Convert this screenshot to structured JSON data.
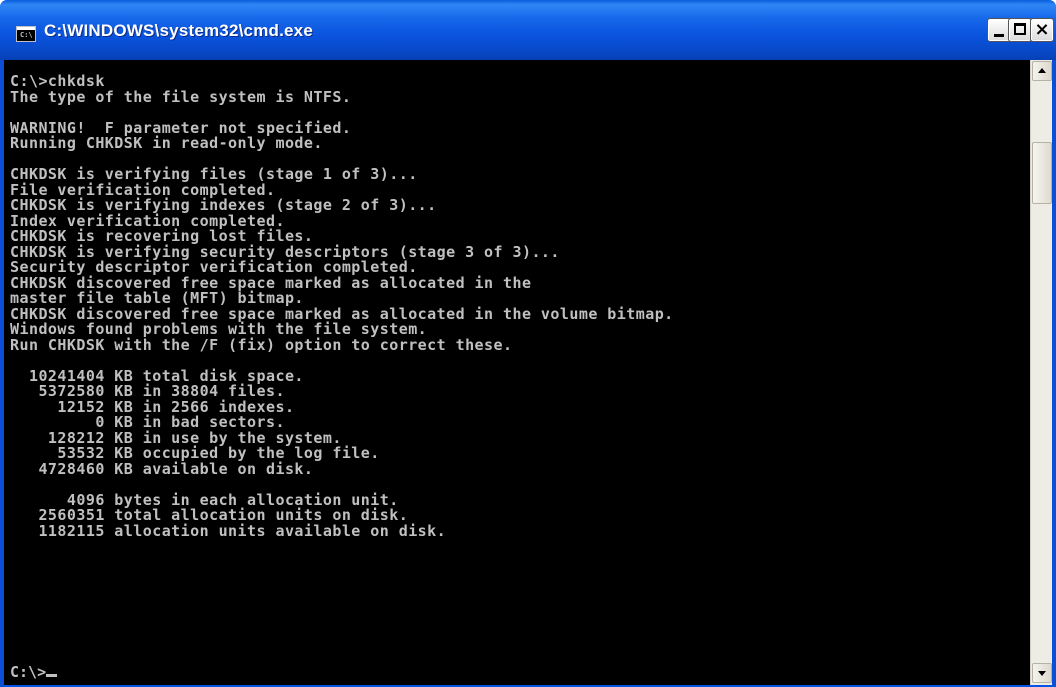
{
  "window": {
    "title": "C:\\WINDOWS\\system32\\cmd.exe",
    "icon_text": "C:\\",
    "icon": "console-icon",
    "buttons": {
      "minimize": "minimize-icon",
      "maximize": "maximize-icon",
      "close_glyph": "×"
    }
  },
  "console": {
    "lines": [
      "C:\\>chkdsk",
      "The type of the file system is NTFS.",
      "",
      "WARNING!  F parameter not specified.",
      "Running CHKDSK in read-only mode.",
      "",
      "CHKDSK is verifying files (stage 1 of 3)...",
      "File verification completed.",
      "CHKDSK is verifying indexes (stage 2 of 3)...",
      "Index verification completed.",
      "CHKDSK is recovering lost files.",
      "CHKDSK is verifying security descriptors (stage 3 of 3)...",
      "Security descriptor verification completed.",
      "CHKDSK discovered free space marked as allocated in the",
      "master file table (MFT) bitmap.",
      "CHKDSK discovered free space marked as allocated in the volume bitmap.",
      "Windows found problems with the file system.",
      "Run CHKDSK with the /F (fix) option to correct these.",
      "",
      "  10241404 KB total disk space.",
      "   5372580 KB in 38804 files.",
      "     12152 KB in 2566 indexes.",
      "         0 KB in bad sectors.",
      "    128212 KB in use by the system.",
      "     53532 KB occupied by the log file.",
      "   4728460 KB available on disk.",
      "",
      "      4096 bytes in each allocation unit.",
      "   2560351 total allocation units on disk.",
      "   1182115 allocation units available on disk."
    ],
    "prompt": "C:\\>"
  },
  "scrollbar": {
    "up_icon": "arrow-up-icon",
    "down_icon": "arrow-down-icon"
  },
  "colors": {
    "console_bg": "#000000",
    "console_fg": "#c0c0c0",
    "titlebar": "#0a53dd"
  }
}
